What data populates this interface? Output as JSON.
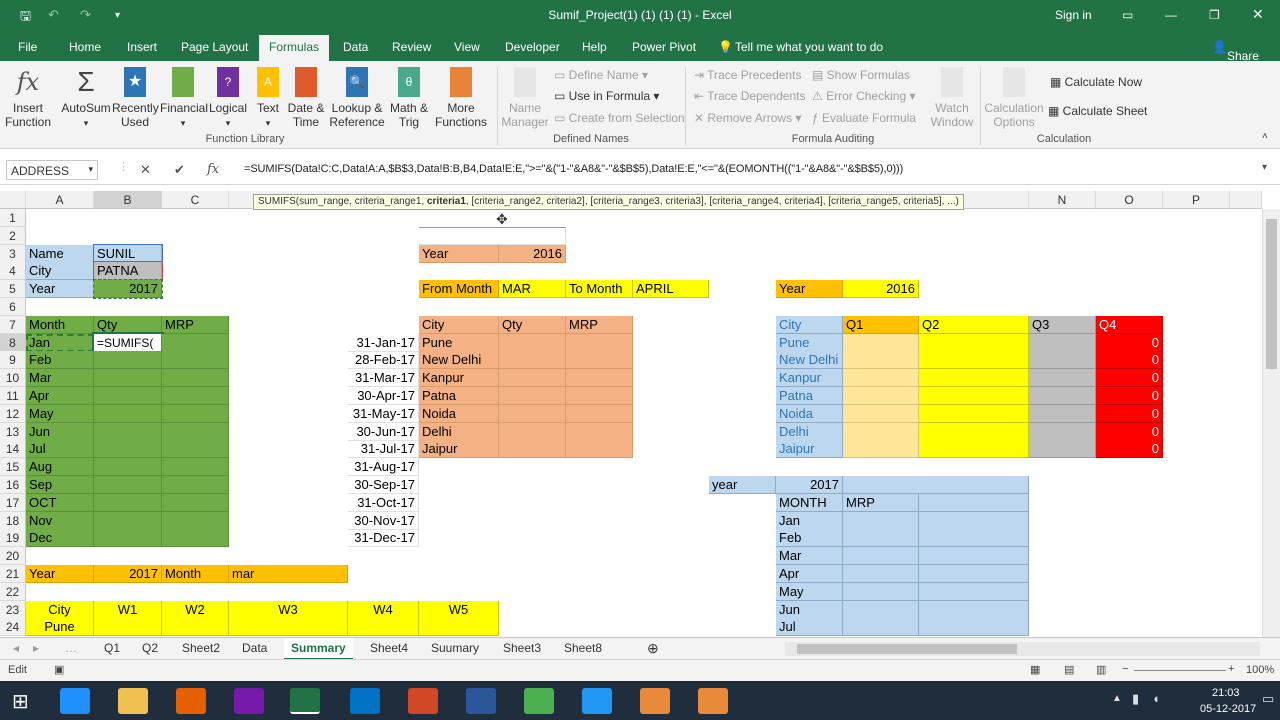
{
  "window": {
    "title": "Sumif_Project(1) (1) (1) (1)  -  Excel",
    "sign_in": "Sign in",
    "share": "Share"
  },
  "tabs": [
    "File",
    "Home",
    "Insert",
    "Page Layout",
    "Formulas",
    "Data",
    "Review",
    "View",
    "Developer",
    "Help",
    "Power Pivot"
  ],
  "tell_me": "Tell me what you want to do",
  "ribbon": {
    "insert_function": "Insert\nFunction",
    "autosum": "AutoSum",
    "recently_used": "Recently\nUsed",
    "financial": "Financial",
    "logical": "Logical",
    "text": "Text",
    "date_time": "Date &\nTime",
    "lookup": "Lookup &\nReference",
    "math": "Math &\nTrig",
    "more": "More\nFunctions",
    "name_manager": "Name\nManager",
    "define_name": "Define Name",
    "use_in_formula": "Use in Formula",
    "create_from_selection": "Create from Selection",
    "trace_precedents": "Trace Precedents",
    "trace_dependents": "Trace Dependents",
    "remove_arrows": "Remove Arrows",
    "show_formulas": "Show Formulas",
    "error_checking": "Error Checking",
    "evaluate_formula": "Evaluate Formula",
    "watch_window": "Watch\nWindow",
    "calc_options": "Calculation\nOptions",
    "calc_now": "Calculate Now",
    "calc_sheet": "Calculate Sheet",
    "groups": [
      "Function Library",
      "Defined Names",
      "Formula Auditing",
      "Calculation"
    ]
  },
  "formula_bar": {
    "name_box": "ADDRESS",
    "formula": "=SUMIFS(Data!C:C,Data!A:A,$B$3,Data!B:B,B4,Data!E:E,\">=\"&(\"1-\"&A8&\"-\"&$B$5),Data!E:E,\"<=\"&(EOMONTH((\"1-\"&A8&\"-\"&$B$5),0)))",
    "tooltip_pre": "SUMIFS(sum_range, criteria_range1, ",
    "tooltip_bold": "criteria1",
    "tooltip_post": ", [criteria_range2, criteria2], [criteria_range3, criteria3], [criteria_range4, criteria4], [criteria_range5, criteria5], ...)"
  },
  "columns": [
    "A",
    "B",
    "C",
    "N",
    "O",
    "P"
  ],
  "rows": [
    "1",
    "2",
    "3",
    "4",
    "5",
    "6",
    "7",
    "8",
    "9",
    "10",
    "11",
    "12",
    "13",
    "14",
    "15",
    "16",
    "17",
    "18",
    "19",
    "20",
    "21",
    "22",
    "23",
    "24"
  ],
  "left_block": {
    "name_label": "Name",
    "name_val": "SUNIL",
    "city_label": "City",
    "city_val": "PATNA",
    "year_label": "Year",
    "year_val": "2017",
    "h_month": "Month",
    "h_qty": "Qty",
    "h_mrp": "MRP",
    "edit_cell": "=SUMIFS(",
    "months": [
      "Jan",
      "Feb",
      "Mar",
      "Apr",
      "May",
      "Jun",
      "Jul",
      "Aug",
      "Sep",
      "OCT",
      "Nov",
      "Dec"
    ],
    "dates": [
      "31-Jan-17",
      "28-Feb-17",
      "31-Mar-17",
      "30-Apr-17",
      "31-May-17",
      "30-Jun-17",
      "31-Jul-17",
      "31-Aug-17",
      "30-Sep-17",
      "31-Oct-17",
      "30-Nov-17",
      "31-Dec-17"
    ],
    "r21": [
      "Year",
      "2017",
      "Month",
      "mar"
    ],
    "weeks": [
      "City",
      "W1",
      "W2",
      "W3",
      "W4",
      "W5"
    ],
    "pune": "Pune"
  },
  "mid_block": {
    "year_label": "Year",
    "year_val": "2016",
    "from": "From Month",
    "from_val": "MAR",
    "to": "To Month",
    "to_val": "APRIL",
    "h_city": "City",
    "h_qty": "Qty",
    "h_mrp": "MRP",
    "cities": [
      "Pune",
      "New Delhi",
      "Kanpur",
      "Patna",
      "Noida",
      "Delhi",
      "Jaipur"
    ]
  },
  "right_block": {
    "year_label": "Year",
    "year_val": "2016",
    "h_city": "City",
    "q1": "Q1",
    "q2": "Q2",
    "q3": "Q3",
    "q4": "Q4",
    "cities": [
      "Pune",
      "New Delhi",
      "Kanpur",
      "Patna",
      "Noida",
      "Delhi",
      "Jaipur"
    ],
    "q4_vals": [
      "0",
      "0",
      "0",
      "0",
      "0",
      "0",
      "0"
    ],
    "year2_label": "year",
    "year2_val": "2017",
    "h_month": "MONTH",
    "h_mrp": "MRP",
    "months": [
      "Jan",
      "Feb",
      "Mar",
      "Apr",
      "May",
      "Jun",
      "Jul"
    ]
  },
  "sheets": [
    "Q1",
    "Q2",
    "Sheet2",
    "Data",
    "Summary",
    "Sheet4",
    "Suumary",
    "Sheet3",
    "Sheet8"
  ],
  "status": {
    "mode": "Edit",
    "zoom": "100%"
  },
  "taskbar": {
    "time": "21:03",
    "date": "05-12-2017"
  }
}
